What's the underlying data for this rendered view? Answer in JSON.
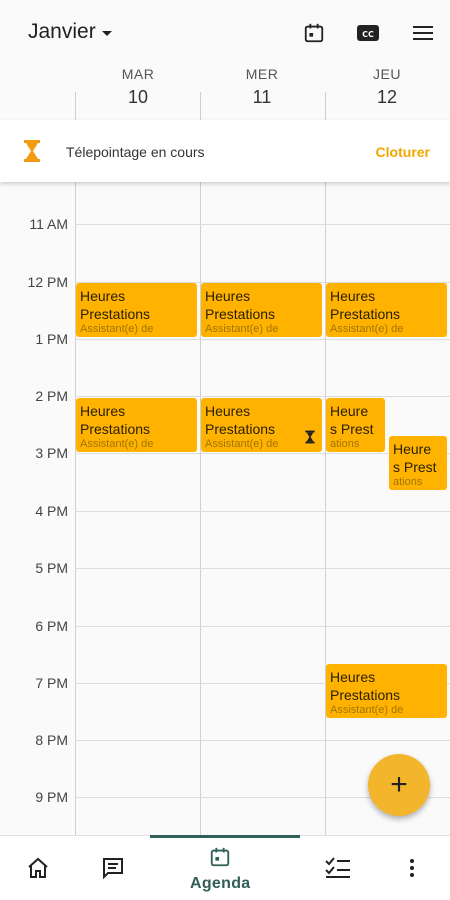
{
  "header": {
    "month_label": "Janvier",
    "icons": [
      "calendar-icon",
      "cc-icon",
      "menu-icon"
    ]
  },
  "days": [
    {
      "dow": "MAR",
      "num": "10"
    },
    {
      "dow": "MER",
      "num": "11"
    },
    {
      "dow": "JEU",
      "num": "12"
    }
  ],
  "banner": {
    "text": "Télepointage en cours",
    "action": "Cloturer",
    "icon": "hourglass-icon"
  },
  "hours": [
    "11 AM",
    "12 PM",
    "1 PM",
    "2 PM",
    "3 PM",
    "4 PM",
    "5 PM",
    "6 PM",
    "7 PM",
    "8 PM",
    "9 PM"
  ],
  "events": [
    {
      "line1": "Heures",
      "line2": "Prestations",
      "sub": "Assistant(e) de"
    },
    {
      "line1": "Heures",
      "line2": "Prestations",
      "sub": "Assistant(e) de"
    },
    {
      "line1": "Heures",
      "line2": "Prestations",
      "sub": "Assistant(e) de"
    },
    {
      "line1": "Heures",
      "line2": "Prestations",
      "sub": "Assistant(e) de"
    },
    {
      "line1": "Heures",
      "line2": "Prestations",
      "sub": "Assistant(e) de"
    },
    {
      "line1": "Heure",
      "line2": "s Prest",
      "sub": "ations"
    },
    {
      "line1": "Heure",
      "line2": "s Prest",
      "sub": "ations"
    },
    {
      "line1": "Heures",
      "line2": "Prestations",
      "sub": "Assistant(e) de"
    }
  ],
  "fab": {
    "label": "+"
  },
  "bottom_nav": {
    "items": [
      "home-icon",
      "message-icon",
      "calendar-icon",
      "checklist-icon",
      "more-icon"
    ],
    "active_label": "Agenda"
  },
  "colors": {
    "event": "#ffb300",
    "accent": "#f0a800",
    "nav_active": "#2f5f56"
  }
}
